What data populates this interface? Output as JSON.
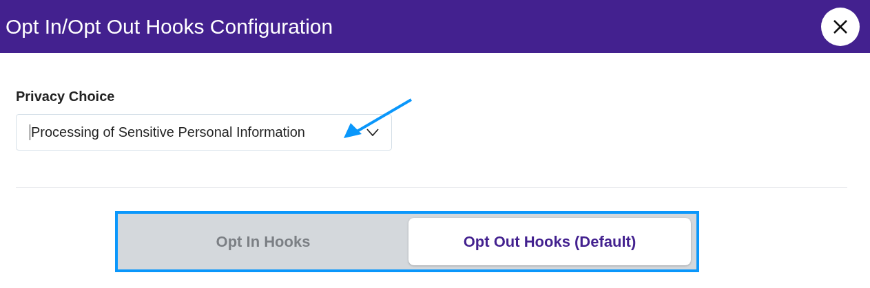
{
  "window": {
    "title": "Opt In/Opt Out Hooks Configuration"
  },
  "privacy_choice": {
    "label": "Privacy Choice",
    "value": "Processing of Sensitive Personal Information"
  },
  "tabs": [
    {
      "label": "Opt In Hooks",
      "selected": false
    },
    {
      "label": "Opt Out Hooks (Default)",
      "selected": true
    }
  ]
}
